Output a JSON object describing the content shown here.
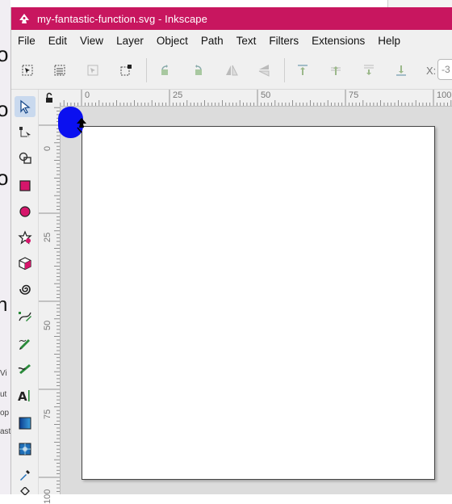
{
  "window": {
    "title": "my-fantastic-function.svg - Inkscape"
  },
  "menu": [
    "File",
    "Edit",
    "View",
    "Layer",
    "Object",
    "Path",
    "Text",
    "Filters",
    "Extensions",
    "Help"
  ],
  "toolbar": {
    "x_label": "X:",
    "x_value": "-3"
  },
  "rulers": {
    "top_labels": [
      "0",
      "25",
      "50",
      "75",
      "100"
    ],
    "left_labels": [
      "0",
      "25",
      "50",
      "75",
      "100"
    ]
  },
  "tools": [
    "selector",
    "node",
    "shape-builder",
    "rectangle",
    "ellipse",
    "star",
    "3d-box",
    "spiral",
    "pen",
    "pencil",
    "calligraphy",
    "text",
    "gradient",
    "mesh",
    "dropper",
    "paint-bucket"
  ],
  "background": {
    "left_fragments": [
      "Vi",
      "ut",
      "op",
      "ast"
    ]
  },
  "colors": {
    "titlebar": "#c8165f",
    "selection_blue": "#0b10f0",
    "accent_pink": "#d6166b"
  }
}
